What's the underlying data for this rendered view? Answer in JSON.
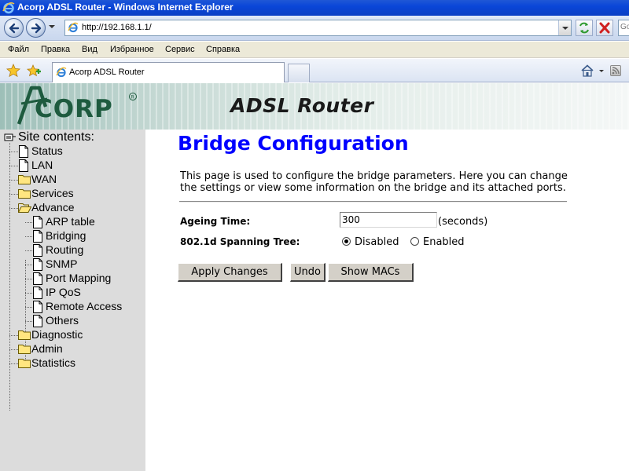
{
  "window": {
    "title": "Acorp ADSL Router - Windows Internet Explorer"
  },
  "browser": {
    "url": "http://192.168.1.1/",
    "search_placeholder": "Go",
    "menu": [
      "Файл",
      "Правка",
      "Вид",
      "Избранное",
      "Сервис",
      "Справка"
    ],
    "tab_title": "Acorp ADSL Router"
  },
  "banner": {
    "logo_text": "ACORP",
    "product": "ADSL Router"
  },
  "sidebar": {
    "title": "Site contents:",
    "items": [
      {
        "label": "Status",
        "icon": "page-icon"
      },
      {
        "label": "LAN",
        "icon": "page-icon"
      },
      {
        "label": "WAN",
        "icon": "folder-icon"
      },
      {
        "label": "Services",
        "icon": "folder-icon"
      },
      {
        "label": "Advance",
        "icon": "folder-open-icon",
        "children": [
          {
            "label": "ARP table"
          },
          {
            "label": "Bridging"
          },
          {
            "label": "Routing"
          },
          {
            "label": "SNMP"
          },
          {
            "label": "Port Mapping"
          },
          {
            "label": "IP QoS"
          },
          {
            "label": "Remote Access"
          },
          {
            "label": "Others"
          }
        ]
      },
      {
        "label": "Diagnostic",
        "icon": "folder-icon"
      },
      {
        "label": "Admin",
        "icon": "folder-icon"
      },
      {
        "label": "Statistics",
        "icon": "folder-icon"
      }
    ]
  },
  "main": {
    "heading": "Bridge Configuration",
    "description": "This page is used to configure the bridge parameters. Here you can change the settings or view some information on the bridge and its attached ports.",
    "ageing_label": "Ageing Time:",
    "ageing_value": "300",
    "ageing_unit": "(seconds)",
    "stp_label": "802.1d Spanning Tree:",
    "stp_options": [
      "Disabled",
      "Enabled"
    ],
    "stp_selected": "Disabled",
    "buttons": {
      "apply": "Apply Changes",
      "undo": "Undo",
      "show_macs": "Show MACs"
    }
  },
  "colors": {
    "heading": "#0000ff",
    "sidebar_bg": "#dcdcdc",
    "titlebar": "#0a46d8"
  }
}
